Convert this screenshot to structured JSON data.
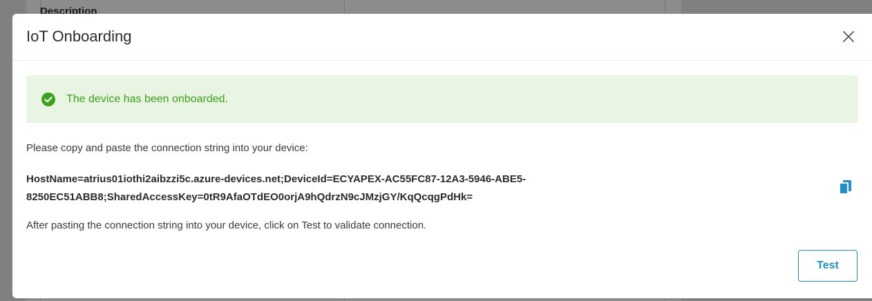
{
  "background": {
    "table_header": "Description"
  },
  "modal": {
    "title": "IoT Onboarding",
    "close_icon": "close-icon",
    "alert": {
      "icon": "check-circle-icon",
      "message": "The device has been onboarded.",
      "color": "#3aa319",
      "background": "#e9f5e3"
    },
    "instruction": "Please copy and paste the connection string into your device:",
    "connection_string_line1": "HostName=atrius01iothi2aibzzi5c.azure-devices.net;DeviceId=ECYAPEX-AC55FC87-12A3-5946-ABE5-",
    "connection_string_line2": "8250EC51ABB8;SharedAccessKey=0tR9AfaOTdEO0orjA9hQdrzN9cJMzjGY/KqQcqgPdHk=",
    "copy_icon": "copy-icon",
    "after_text": "After pasting the connection string into your device, click on Test to validate connection.",
    "test_button_label": "Test",
    "accent_color": "#1f8fd1"
  }
}
